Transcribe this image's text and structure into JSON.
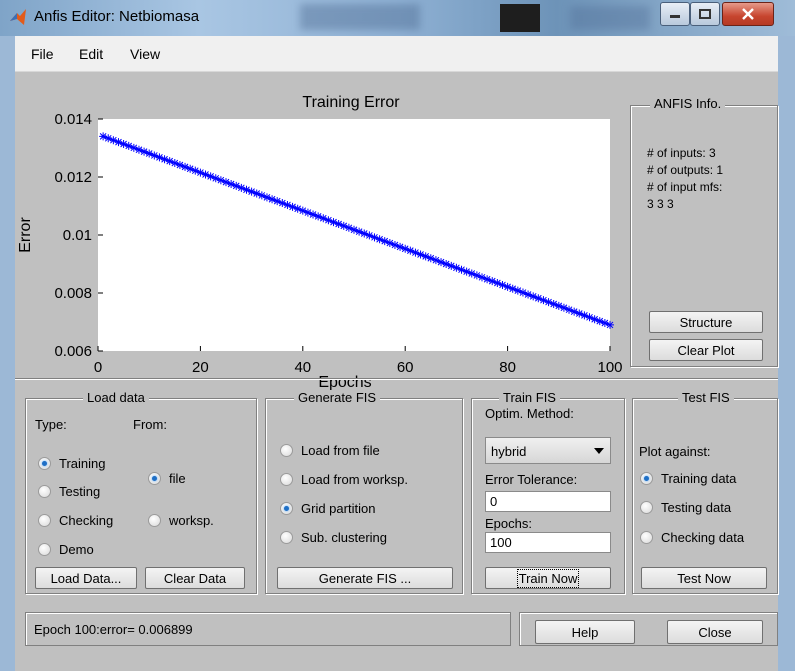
{
  "window": {
    "title": "Anfis Editor: Netbiomasa"
  },
  "menu": {
    "items": [
      "File",
      "Edit",
      "View"
    ]
  },
  "chart_data": {
    "type": "line",
    "title": "Training Error",
    "xlabel": "Epochs",
    "ylabel": "Error",
    "xlim": [
      0,
      100
    ],
    "ylim": [
      0.006,
      0.014
    ],
    "xticks": [
      "0",
      "20",
      "40",
      "60",
      "80",
      "100"
    ],
    "yticks": [
      "0.006",
      "0.008",
      "0.01",
      "0.012",
      "0.014"
    ],
    "grid": false,
    "marker": "asterisk",
    "series": [
      {
        "color": "#0000ff",
        "x": [
          1,
          100
        ],
        "y": [
          0.0134,
          0.006899
        ]
      }
    ]
  },
  "info_panel": {
    "title": "ANFIS Info.",
    "lines": [
      "# of inputs: 3",
      "# of outputs: 1",
      "# of input mfs:",
      "3  3  3"
    ],
    "structure_button": "Structure",
    "clear_plot_button": "Clear Plot"
  },
  "load_data": {
    "title": "Load data",
    "type_label": "Type:",
    "from_label": "From:",
    "types": [
      "Training",
      "Testing",
      "Checking",
      "Demo"
    ],
    "selected_type": "Training",
    "sources": [
      "file",
      "worksp."
    ],
    "selected_source": "file",
    "load_button": "Load Data...",
    "clear_button": "Clear Data"
  },
  "generate_fis": {
    "title": "Generate FIS",
    "options": [
      "Load from file",
      "Load from worksp.",
      "Grid partition",
      "Sub. clustering"
    ],
    "selected": "Grid partition",
    "button": "Generate FIS ..."
  },
  "train_fis": {
    "title": "Train FIS",
    "method_label": "Optim. Method:",
    "method_value": "hybrid",
    "tolerance_label": "Error Tolerance:",
    "tolerance_value": "0",
    "epochs_label": "Epochs:",
    "epochs_value": "100",
    "button": "Train Now"
  },
  "test_fis": {
    "title": "Test FIS",
    "plot_against_label": "Plot against:",
    "options": [
      "Training data",
      "Testing data",
      "Checking data"
    ],
    "selected": "Training data",
    "button": "Test Now"
  },
  "status": {
    "text": "Epoch 100:error= 0.006899"
  },
  "footer": {
    "help_button": "Help",
    "close_button": "Close"
  }
}
